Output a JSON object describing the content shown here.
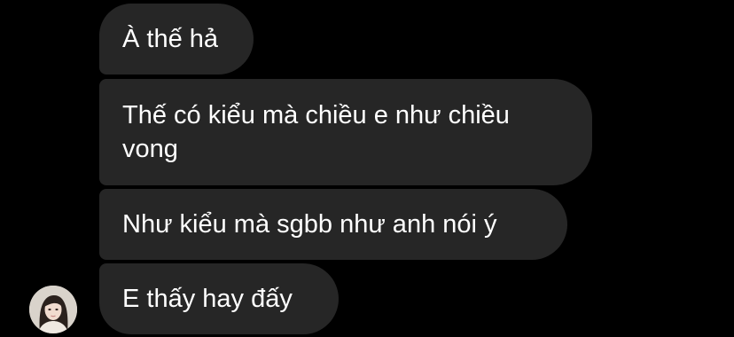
{
  "chat": {
    "messages": [
      {
        "text": "À thế hả"
      },
      {
        "text": "Thế có kiểu mà chiều e như chiều\nvong"
      },
      {
        "text": "Như kiểu mà sgbb như anh nói ý"
      },
      {
        "text": "E thấy hay đấy"
      }
    ],
    "avatar": {
      "icon": "user-avatar-photo"
    }
  },
  "colors": {
    "background": "#000000",
    "bubble": "#262626",
    "text": "#ffffff"
  }
}
